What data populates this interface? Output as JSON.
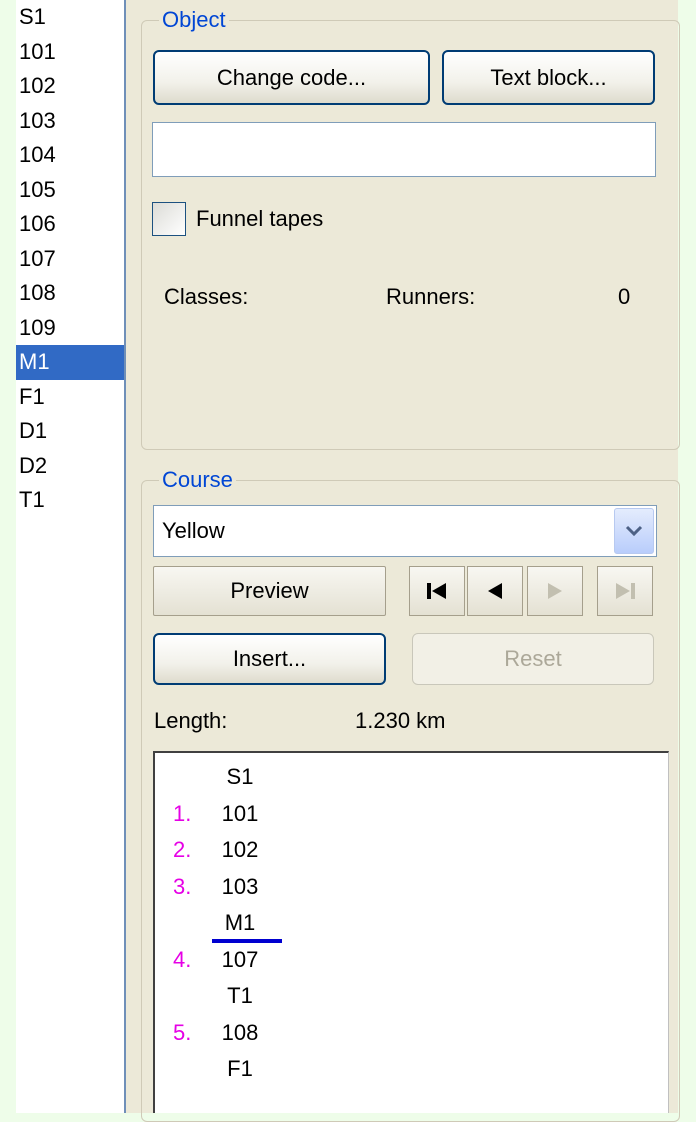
{
  "controls": {
    "items": [
      "S1",
      "101",
      "102",
      "103",
      "104",
      "105",
      "106",
      "107",
      "108",
      "109",
      "M1",
      "F1",
      "D1",
      "D2",
      "T1"
    ],
    "selected": "M1"
  },
  "object_group": {
    "title": "Object",
    "change_code_label": "Change code...",
    "text_block_label": "Text block...",
    "code_value": "",
    "funnel_tapes_label": "Funnel tapes",
    "funnel_tapes_checked": false,
    "classes_label": "Classes:",
    "runners_label": "Runners:",
    "runners_value": "0"
  },
  "course_group": {
    "title": "Course",
    "course_selected": "Yellow",
    "preview_label": "Preview",
    "insert_label": "Insert...",
    "reset_label": "Reset",
    "length_label": "Length:",
    "length_value": "1.230 km",
    "nav_icons": [
      "first-icon",
      "previous-icon",
      "next-icon",
      "last-icon"
    ],
    "legs": [
      {
        "num": "",
        "code": "S1"
      },
      {
        "num": "1.",
        "code": "101"
      },
      {
        "num": "2.",
        "code": "102"
      },
      {
        "num": "3.",
        "code": "103"
      },
      {
        "num": "",
        "code": "M1",
        "selected": true
      },
      {
        "num": "4.",
        "code": "107"
      },
      {
        "num": "",
        "code": "T1"
      },
      {
        "num": "5.",
        "code": "108"
      },
      {
        "num": "",
        "code": "F1"
      }
    ]
  },
  "colors": {
    "selection": "#316ac5",
    "leg_number": "#e600e6",
    "group_title": "#0046d5",
    "insertion_marker": "#0000d0"
  }
}
